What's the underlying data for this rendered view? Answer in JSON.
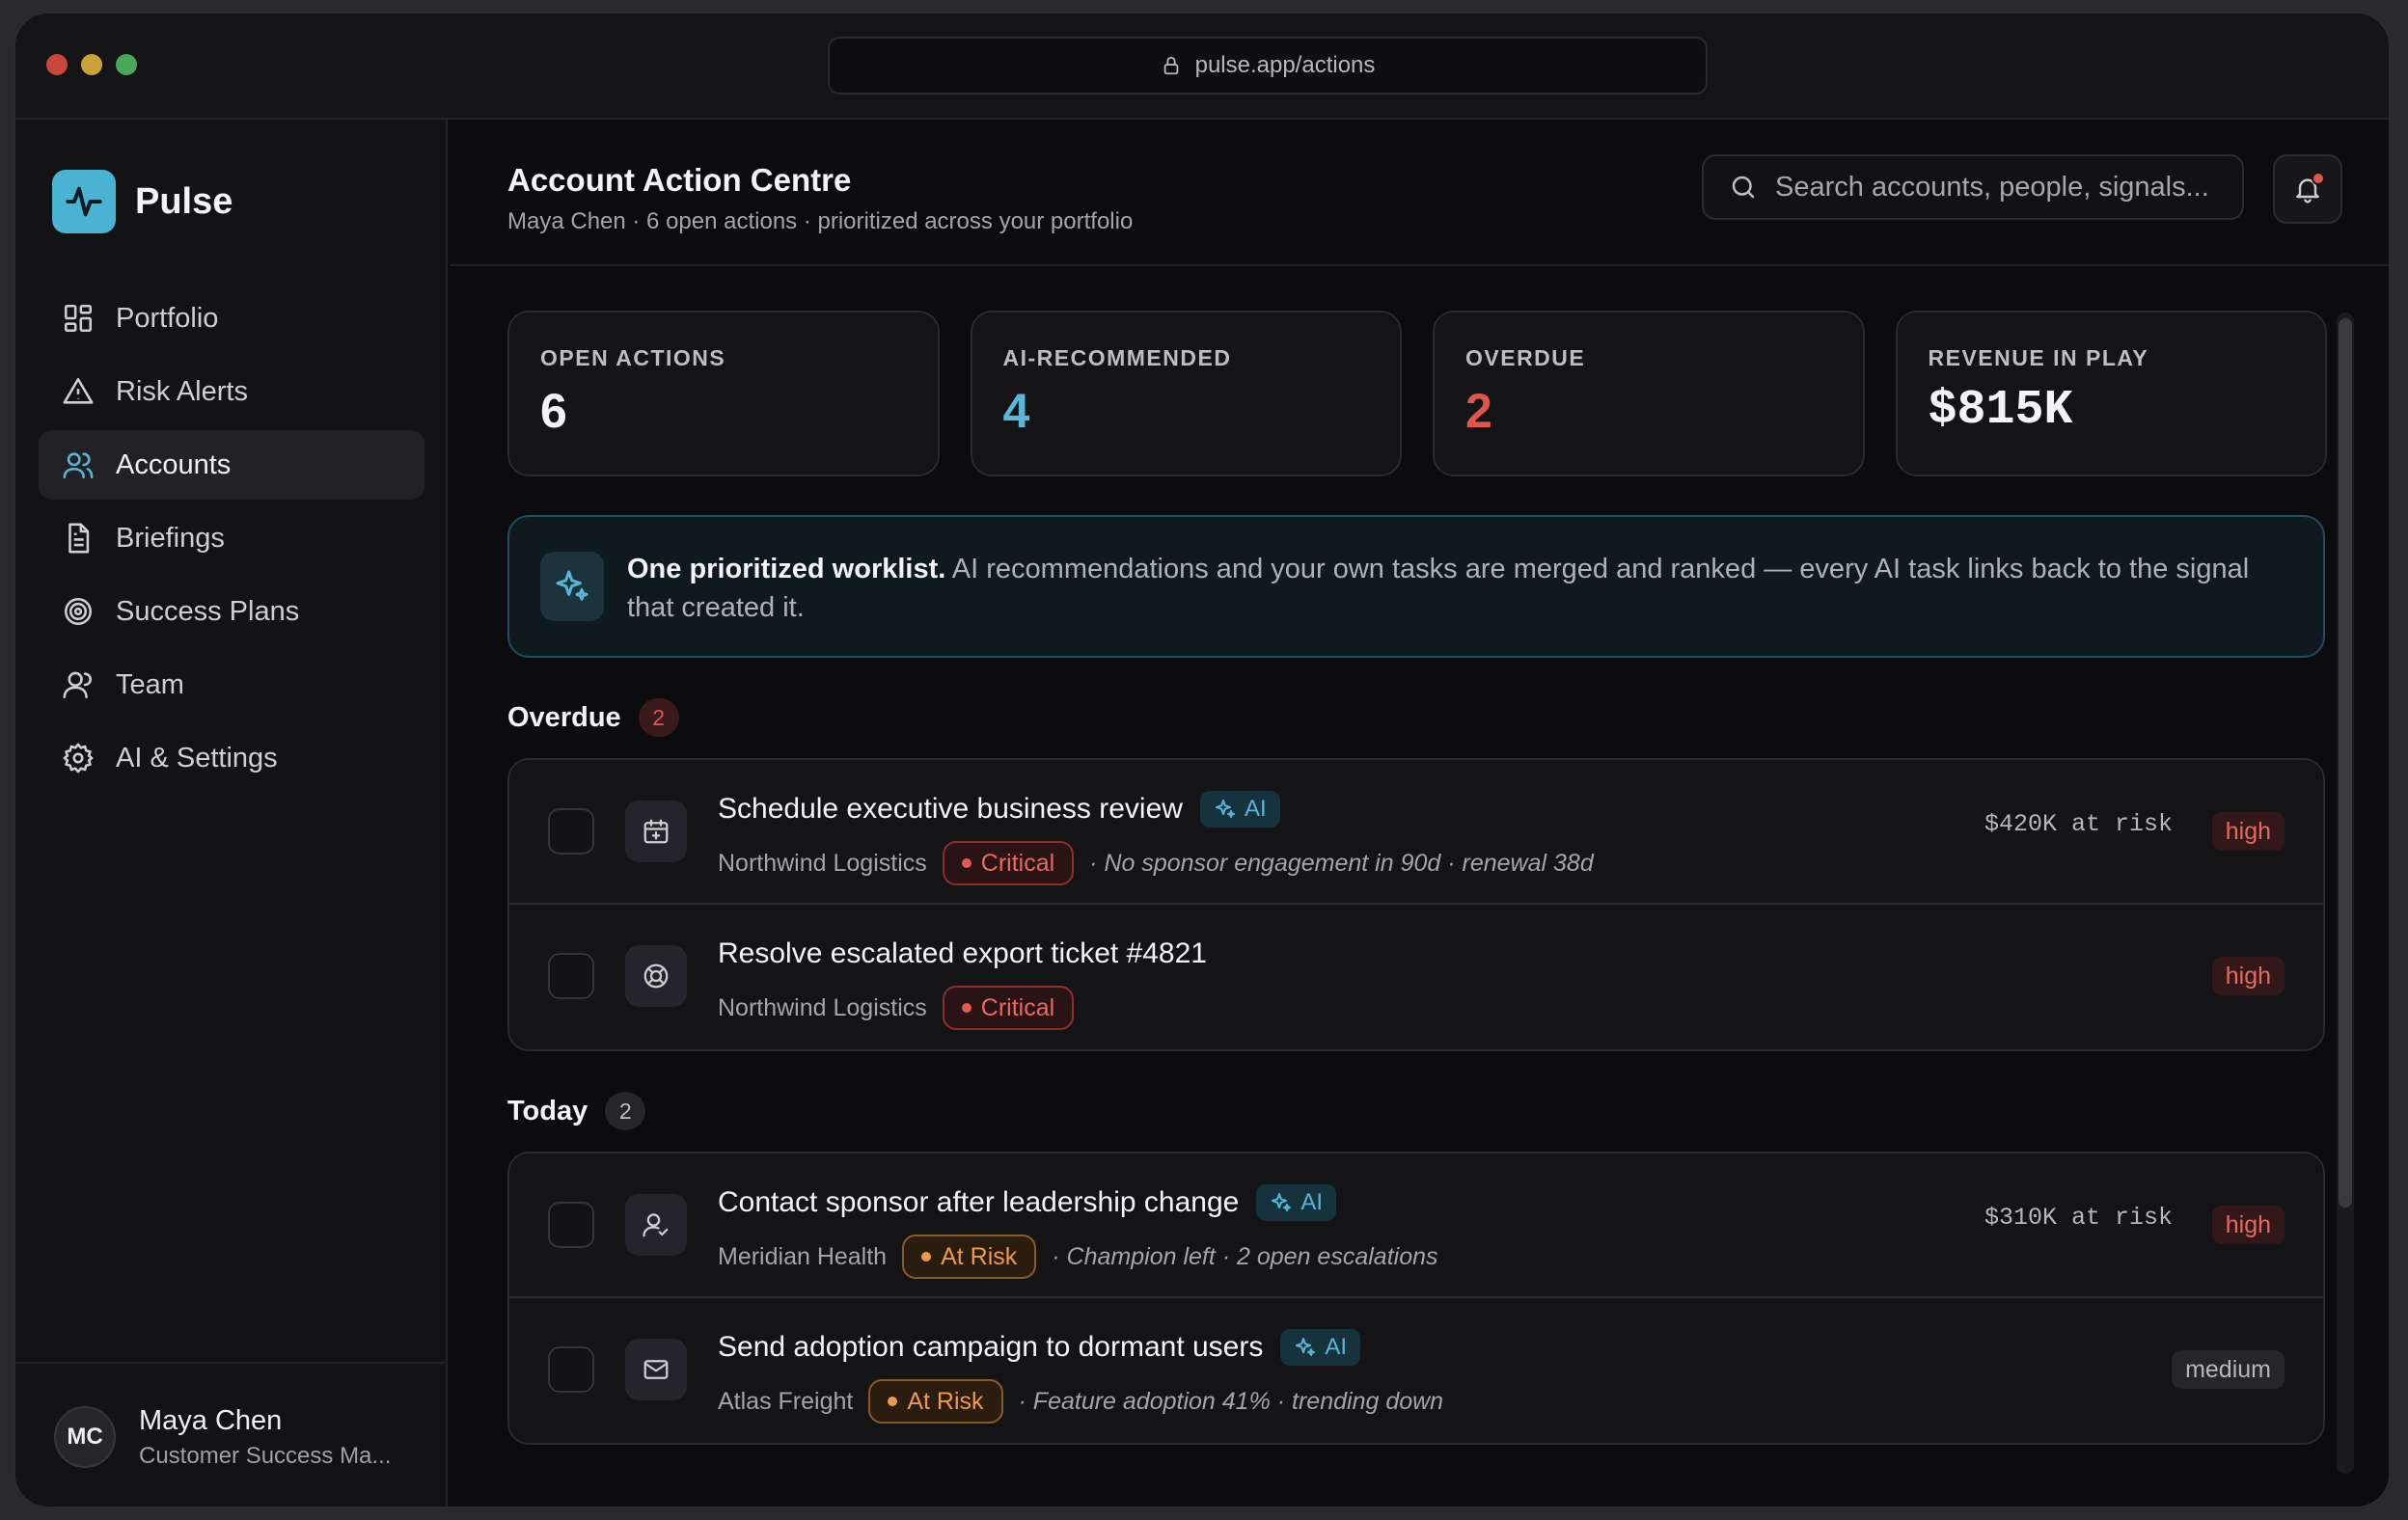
{
  "browser": {
    "url": "pulse.app/actions"
  },
  "brand": {
    "name": "Pulse"
  },
  "sidebar": {
    "items": [
      {
        "label": "Portfolio",
        "icon": "grid-icon"
      },
      {
        "label": "Risk Alerts",
        "icon": "warning-triangle-icon"
      },
      {
        "label": "Accounts",
        "icon": "users-icon",
        "active": true
      },
      {
        "label": "Briefings",
        "icon": "document-icon"
      },
      {
        "label": "Success Plans",
        "icon": "target-icon"
      },
      {
        "label": "Team",
        "icon": "user-icon"
      },
      {
        "label": "AI & Settings",
        "icon": "gear-icon"
      }
    ],
    "user": {
      "initials": "MC",
      "name": "Maya Chen",
      "role": "Customer Success Ma..."
    }
  },
  "header": {
    "title": "Account Action Centre",
    "subtitle": "Maya Chen · 6 open actions · prioritized across your portfolio",
    "search_placeholder": "Search accounts, people, signals..."
  },
  "stats": [
    {
      "label": "OPEN ACTIONS",
      "value": "6",
      "color": "#f4f4f6"
    },
    {
      "label": "AI-RECOMMENDED",
      "value": "4",
      "color": "#5ab6d6"
    },
    {
      "label": "OVERDUE",
      "value": "2",
      "color": "#e0564c"
    },
    {
      "label": "REVENUE IN PLAY",
      "value": "$815K",
      "color": "#f4f4f6"
    }
  ],
  "banner": {
    "bold": "One prioritized worklist.",
    "text": "AI recommendations and your own tasks are merged and ranked — every AI task links back to the signal that created it."
  },
  "sections": [
    {
      "title": "Overdue",
      "count": "2",
      "rows": [
        {
          "icon": "calendar-plus-icon",
          "title": "Schedule executive business review",
          "ai": "AI",
          "account": "Northwind Logistics",
          "status": "Critical",
          "signal": "· No sponsor engagement in 90d · renewal 38d",
          "risk": "$420K at risk",
          "priority": "high"
        },
        {
          "icon": "lifebuoy-icon",
          "title": "Resolve escalated export ticket #4821",
          "ai": "",
          "account": "Northwind Logistics",
          "status": "Critical",
          "signal": "",
          "risk": "",
          "priority": "high"
        }
      ]
    },
    {
      "title": "Today",
      "count": "2",
      "rows": [
        {
          "icon": "user-check-icon",
          "title": "Contact sponsor after leadership change",
          "ai": "AI",
          "account": "Meridian Health",
          "status": "At Risk",
          "signal": "· Champion left · 2 open escalations",
          "risk": "$310K at risk",
          "priority": "high"
        },
        {
          "icon": "mail-icon",
          "title": "Send adoption campaign to dormant users",
          "ai": "AI",
          "account": "Atlas Freight",
          "status": "At Risk",
          "signal": "· Feature adoption 41% · trending down",
          "risk": "",
          "priority": "medium"
        }
      ]
    }
  ]
}
